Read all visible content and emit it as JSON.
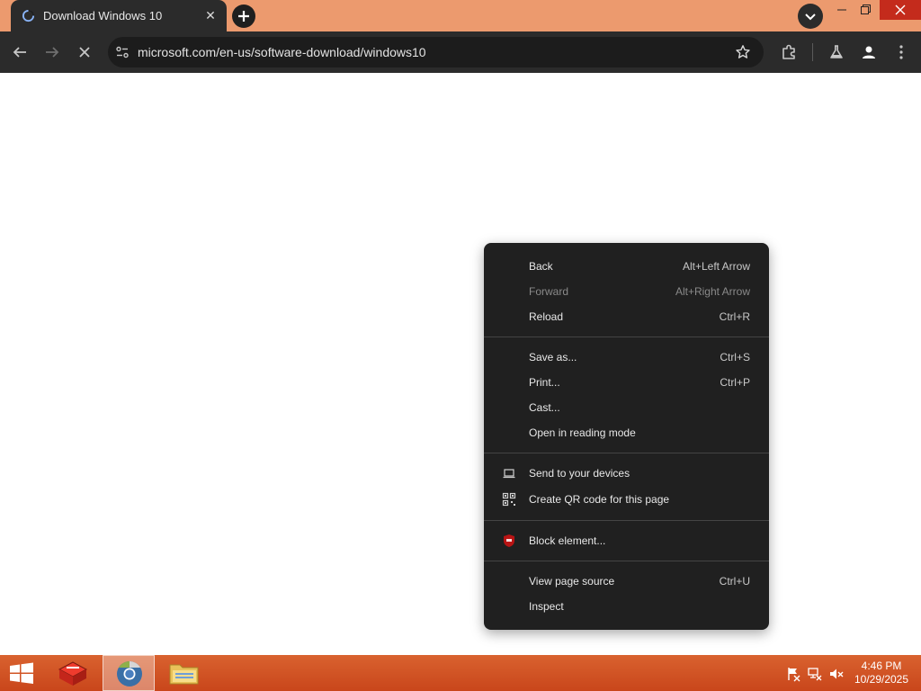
{
  "browser": {
    "tab": {
      "title": "Download Windows 10"
    },
    "omnibox": {
      "url": "microsoft.com/en-us/software-download/windows10"
    },
    "accent_color": "#ec9a6e"
  },
  "context_menu": {
    "groups": [
      [
        {
          "label": "Back",
          "shortcut": "Alt+Left Arrow",
          "enabled": true
        },
        {
          "label": "Forward",
          "shortcut": "Alt+Right Arrow",
          "enabled": false
        },
        {
          "label": "Reload",
          "shortcut": "Ctrl+R",
          "enabled": true
        }
      ],
      [
        {
          "label": "Save as...",
          "shortcut": "Ctrl+S",
          "enabled": true
        },
        {
          "label": "Print...",
          "shortcut": "Ctrl+P",
          "enabled": true
        },
        {
          "label": "Cast...",
          "shortcut": "",
          "enabled": true
        },
        {
          "label": "Open in reading mode",
          "shortcut": "",
          "enabled": true
        }
      ],
      [
        {
          "label": "Send to your devices",
          "shortcut": "",
          "icon": "laptop-icon",
          "enabled": true
        },
        {
          "label": "Create QR code for this page",
          "shortcut": "",
          "icon": "qr-code-icon",
          "enabled": true
        }
      ],
      [
        {
          "label": "Block element...",
          "shortcut": "",
          "icon": "ublock-origin-icon",
          "enabled": true
        }
      ],
      [
        {
          "label": "View page source",
          "shortcut": "Ctrl+U",
          "enabled": true
        },
        {
          "label": "Inspect",
          "shortcut": "",
          "enabled": true
        }
      ]
    ]
  },
  "taskbar": {
    "clock": {
      "time": "4:46 PM",
      "date": "10/29/2025"
    },
    "color": "#d0532a"
  }
}
